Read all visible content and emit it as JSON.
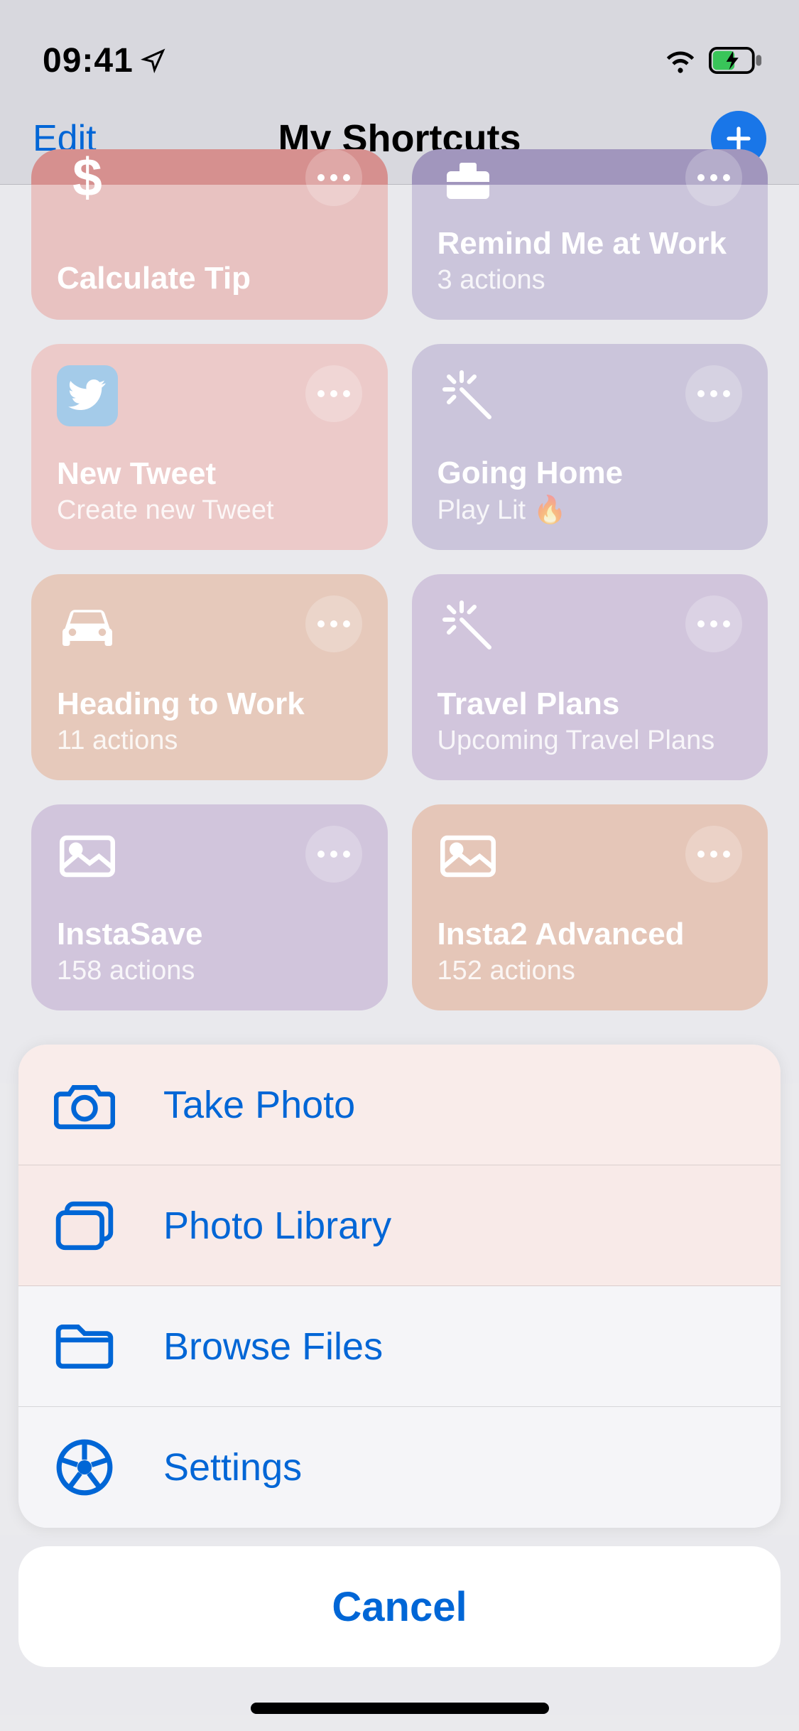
{
  "status": {
    "time": "09:41"
  },
  "nav": {
    "edit": "Edit",
    "title": "My Shortcuts"
  },
  "cards": [
    {
      "title": "Calculate Tip",
      "subtitle": ""
    },
    {
      "title": "Remind Me at Work",
      "subtitle": "3 actions"
    },
    {
      "title": "New Tweet",
      "subtitle": "Create new Tweet"
    },
    {
      "title": "Going Home",
      "subtitle": "Play Lit 🔥"
    },
    {
      "title": "Heading to Work",
      "subtitle": "11 actions"
    },
    {
      "title": "Travel Plans",
      "subtitle": "Upcoming Travel Plans"
    },
    {
      "title": "InstaSave",
      "subtitle": "158 actions"
    },
    {
      "title": "Insta2 Advanced",
      "subtitle": "152 actions"
    }
  ],
  "sheet": {
    "items": [
      {
        "label": "Take Photo"
      },
      {
        "label": "Photo Library"
      },
      {
        "label": "Browse Files"
      },
      {
        "label": "Settings"
      }
    ],
    "cancel": "Cancel"
  }
}
